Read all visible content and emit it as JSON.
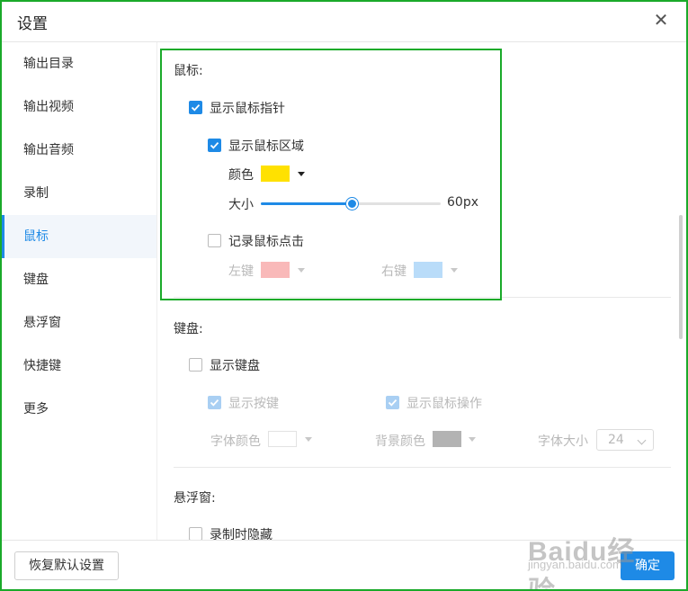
{
  "window": {
    "title": "设置",
    "close_icon": "close-icon"
  },
  "sidebar": {
    "items": [
      {
        "label": "输出目录",
        "active": false
      },
      {
        "label": "输出视频",
        "active": false
      },
      {
        "label": "输出音频",
        "active": false
      },
      {
        "label": "录制",
        "active": false
      },
      {
        "label": "鼠标",
        "active": true
      },
      {
        "label": "键盘",
        "active": false
      },
      {
        "label": "悬浮窗",
        "active": false
      },
      {
        "label": "快捷键",
        "active": false
      },
      {
        "label": "更多",
        "active": false
      }
    ]
  },
  "mouse": {
    "title": "鼠标:",
    "show_pointer": {
      "label": "显示鼠标指针",
      "checked": true
    },
    "show_area": {
      "label": "显示鼠标区域",
      "checked": true
    },
    "color": {
      "label": "颜色",
      "value": "#ffe100"
    },
    "size": {
      "label": "大小",
      "value_text": "60px",
      "fraction": 0.5
    },
    "record_clicks": {
      "label": "记录鼠标点击",
      "checked": false
    },
    "left_key": {
      "label": "左键",
      "color": "#f9b9b9"
    },
    "right_key": {
      "label": "右键",
      "color": "#b9dcf9"
    }
  },
  "keyboard": {
    "title": "键盘:",
    "show_keyboard": {
      "label": "显示键盘",
      "checked": false
    },
    "show_keys": {
      "label": "显示按键",
      "checked": true
    },
    "show_mouse_ops": {
      "label": "显示鼠标操作",
      "checked": true
    },
    "font_color": {
      "label": "字体颜色",
      "value": "#ffffff"
    },
    "bg_color": {
      "label": "背景颜色",
      "value": "#b3b3b3"
    },
    "font_size": {
      "label": "字体大小",
      "value": "24"
    }
  },
  "floating": {
    "title": "悬浮窗:",
    "hide_when_recording": {
      "label": "录制时隐藏",
      "checked": false
    }
  },
  "footer": {
    "reset_label": "恢复默认设置",
    "ok_label": "确定"
  },
  "watermark": {
    "brand": "Baidu经验",
    "url": "jingyan.baidu.com"
  },
  "colors": {
    "accent": "#1e8ae6",
    "highlight_border": "#1aaa2a"
  }
}
